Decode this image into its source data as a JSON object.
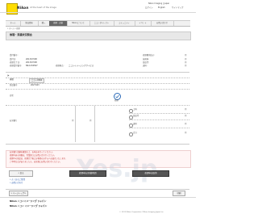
{
  "header": {
    "logo_text": "Nikon",
    "tagline": "At the heart of the image",
    "site_label": "Nikon Imaging | Japan",
    "links": [
      "ログイン",
      "English",
      "サイトマップ"
    ]
  },
  "nav": {
    "items": [
      "ホーム",
      "製品情報",
      "購入",
      "修理・点検",
      "Nikonについて",
      "ニコンダイレクト",
      "コミュニティ",
      "イベント",
      "お問い合わせ"
    ],
    "active_index": 3
  },
  "breadcrumb": "» ホーム » 修理",
  "page": {
    "title": "修理・見積状況照会"
  },
  "info": {
    "left_labels": [
      "受付番号:",
      "受付日:",
      "修理完了日:",
      "修理受付番号:"
    ],
    "left_values": [
      "",
      "2013/07/08",
      "2013/07/08",
      "NK-1234567"
    ],
    "mid_label": "修理拠点:",
    "mid_value": "ニコンイメージングサービス",
    "right_labels": [
      "修理費(税込):",
      "技術料:",
      "部品代:",
      "送料:"
    ],
    "right_units": [
      "円",
      "円",
      "円",
      "円"
    ]
  },
  "product": {
    "model_label": "機種",
    "model_value": "ニコン D800 ",
    "serial_label": "製品番号",
    "serial_value": "2027423",
    "symptom_label": "症状",
    "estimate_label": "お見積り",
    "unit": "円",
    "circle_caption": "修理",
    "estimate_rows": [
      "工料",
      "部品代",
      "送料",
      "合計"
    ]
  },
  "notice": {
    "lines": [
      "お見積り金額を確認の上、お申込を行ってください。",
      "修理内容の詳細は、営業窓口にお問い合わせください。",
      "修理中の商品は、修理完了後にお客様のお手元へお届けいたします。",
      "ご不明な点がありましたら、お気軽にお問い合わせください。"
    ]
  },
  "buttons": {
    "back": "« 戻る",
    "apply": "修理申込(見積承認)",
    "cancel": "修理申込取消",
    "print": "印刷"
  },
  "links": {
    "help": "» よくあるご質問",
    "inquiry": "» お問い合わせ"
  },
  "footer": {
    "page_top": "» ページトップへ",
    "logo_line1": "Nikon ニコンイメージング ジャパン",
    "logo_line2": "Nikon ニコン イメージング ジャパン",
    "copyright": "© 2013 Nikon Corporation / Nikon Imaging Japan Inc."
  },
  "watermark": "Yes.jp"
}
